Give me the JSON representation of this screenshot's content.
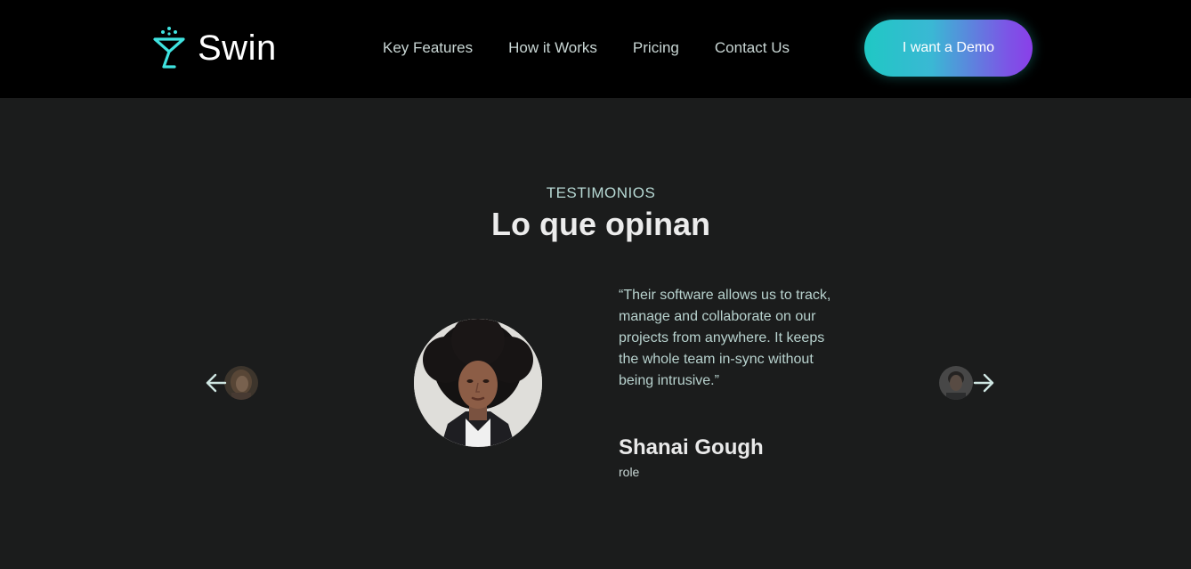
{
  "brand": {
    "name": "Swin",
    "accent": "#3fe3e0"
  },
  "nav": {
    "items": [
      {
        "label": "Key Features"
      },
      {
        "label": "How it Works"
      },
      {
        "label": "Pricing"
      },
      {
        "label": "Contact Us"
      }
    ]
  },
  "cta": {
    "label": "I want a Demo",
    "gradient": [
      "#1fc8c4",
      "#8a3fe8"
    ]
  },
  "testimonials": {
    "eyebrow": "TESTIMONIOS",
    "title": "Lo que opinan",
    "current": {
      "quote": "“Their software allows us to track, manage and collaborate on our projects from anywhere. It keeps the whole team in-sync without being intrusive.”",
      "name": "Shanai Gough",
      "role": "role"
    },
    "prev_icon": "arrow-left-icon",
    "next_icon": "arrow-right-icon"
  }
}
